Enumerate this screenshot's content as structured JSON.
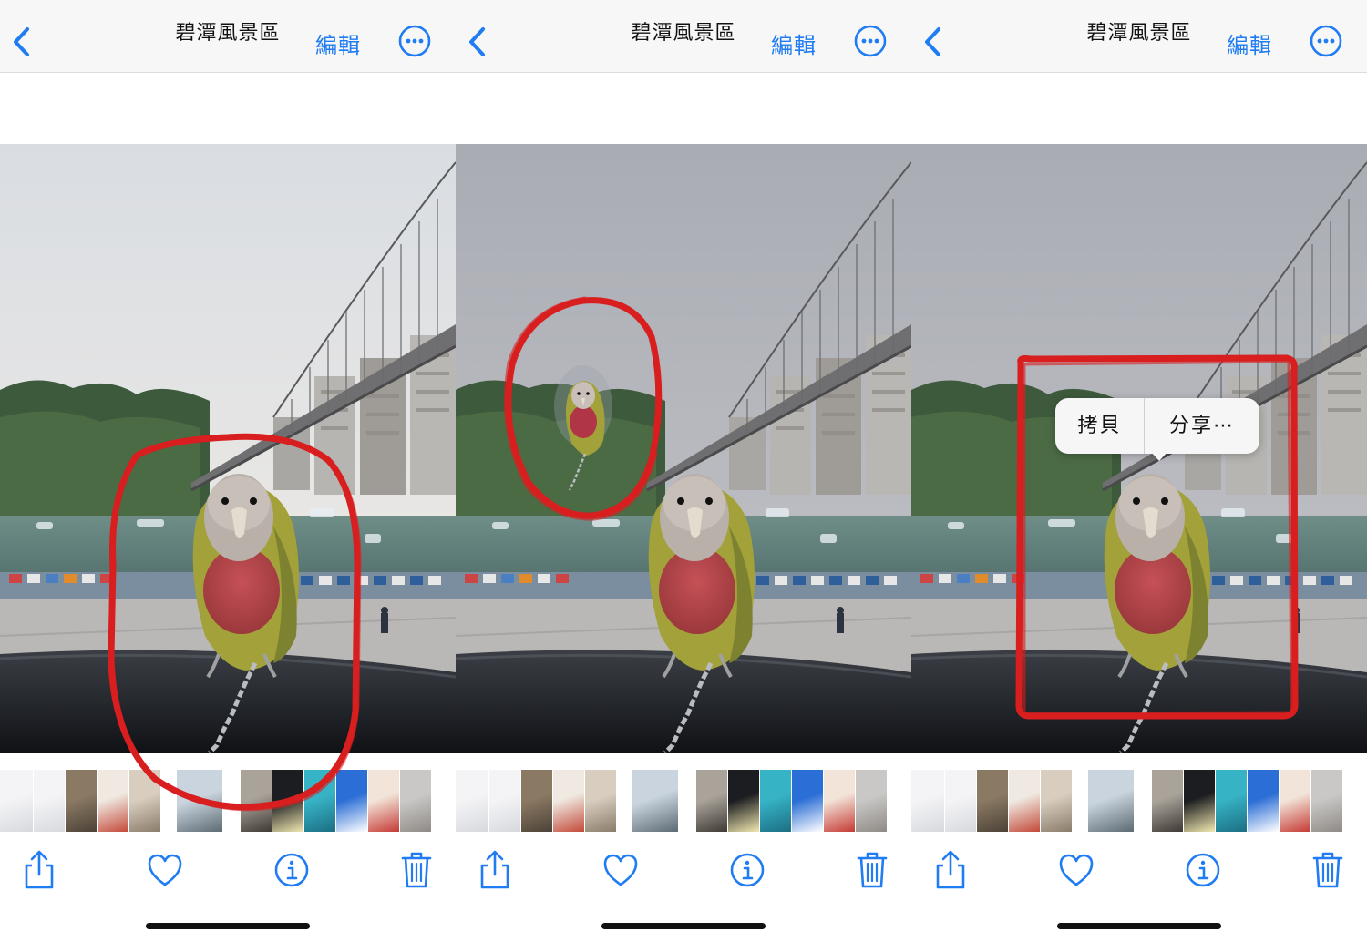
{
  "panels": [
    {
      "nav": {
        "title": "碧潭風景區",
        "edit_label": "編輯"
      },
      "context_menu": null
    },
    {
      "nav": {
        "title": "碧潭風景區",
        "edit_label": "編輯"
      },
      "context_menu": null
    },
    {
      "nav": {
        "title": "碧潭風景區",
        "edit_label": "編輯"
      },
      "context_menu": {
        "copy_label": "拷貝",
        "share_label": "分享⋯"
      }
    }
  ],
  "icons": {
    "back": "chevron-left-icon",
    "more": "ellipsis-circle-icon",
    "share": "share-icon",
    "favorite": "heart-icon",
    "info": "info-icon",
    "delete": "trash-icon"
  },
  "colors": {
    "accent": "#1f7cf2",
    "annotation_red": "#d81e1e",
    "nav_background": "#f7f7f8"
  },
  "thumbnail_kinds": [
    "screenshot",
    "screenshot",
    "pet",
    "lucky-cat",
    "dog",
    "blank",
    "bridge",
    "blank",
    "photo",
    "moon",
    "dolphin",
    "wifi-poster",
    "cat",
    "cat-floor"
  ]
}
